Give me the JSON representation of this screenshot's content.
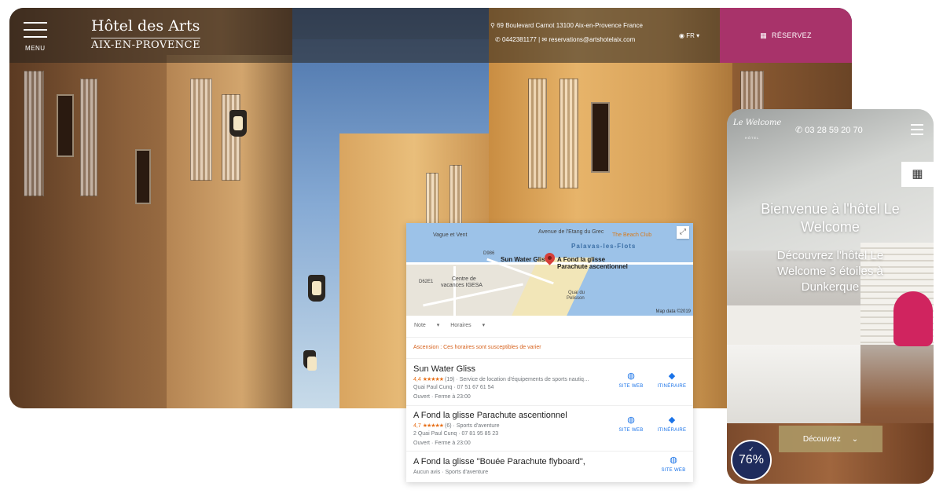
{
  "desktop": {
    "menu_label": "MENU",
    "logo_title": "Hôtel des Arts",
    "logo_subtitle": "AIX-EN-PROVENCE",
    "address": "69 Boulevard Carnot 13100 Aix-en-Provence France",
    "phone": "0442381177",
    "email": "reservations@artshotelaix.com",
    "contact_separator": "|",
    "language": "FR",
    "reserve_label": "RÉSERVEZ",
    "accent_color": "#a8336a"
  },
  "map_card": {
    "map_labels": {
      "vague_et_vent": "Vague et Vent",
      "avenue": "Avenue de l'Etang du Grec",
      "beach_club": "The Beach Club",
      "palavas": "Palavas-les-Flots",
      "sun_water_gliss": "Sun Water Gliss",
      "a_fond_pin": "A Fond la glisse",
      "parachute": "Parachute ascentionnel",
      "centre": "Centre de",
      "vacances": "vacances IGESA",
      "d986": "D986",
      "d62": "D62E1",
      "quai": "Quai du",
      "quai2": "Pelisson",
      "credit": "Map data ©2019"
    },
    "filter_note": "Note",
    "filter_hours": "Horaires",
    "notice": "Ascension : Ces horaires sont susceptibles de varier",
    "places": [
      {
        "name": "Sun Water Gliss",
        "rating": "4,4",
        "stars": "★★★★★",
        "reviews": "(19)",
        "category": "· Service de location d'équipements de sports nautiq…",
        "address": "Quai Paul Cunq · 07 51 67 61 54",
        "hours": "Ouvert · Ferme à 23:00",
        "website": "SITE WEB",
        "itinerary": "ITINÉRAIRE"
      },
      {
        "name": "A Fond la glisse Parachute ascentionnel",
        "rating": "4,7",
        "stars": "★★★★★",
        "reviews": "(6)",
        "category": "· Sports d'aventure",
        "address": "2 Quai Paul Cunq · 07 81 95 85 23",
        "hours": "Ouvert · Ferme à 23:00",
        "website": "SITE WEB",
        "itinerary": "ITINÉRAIRE"
      },
      {
        "name": "A Fond la glisse \"Bouée Parachute flyboard\",",
        "no_reviews": "Aucun avis · Sports d'aventure",
        "website": "SITE WEB"
      }
    ]
  },
  "mobile": {
    "logo": "Le Welcome",
    "logo_sub": "HÔTEL",
    "phone": "03 28 59 20 70",
    "title": "Bienvenue à l'hôtel Le Welcome",
    "subtitle": "Découvrez l'hôtel Le Welcome 3 étoiles à Dunkerque",
    "cta_label": "Découvrez",
    "badge_percent": "76%",
    "badge_color": "#1f2c5c"
  }
}
